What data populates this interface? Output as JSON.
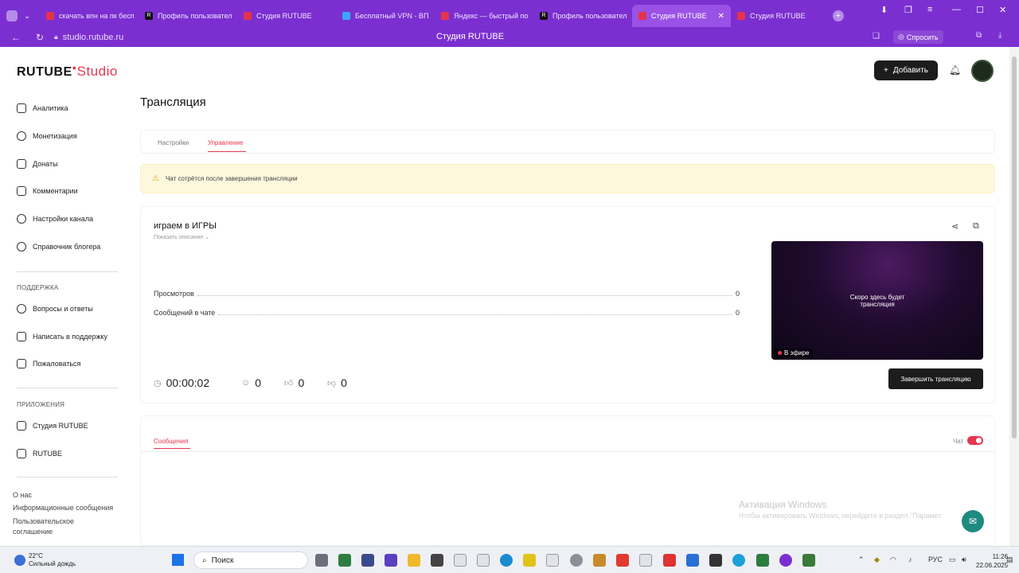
{
  "browser": {
    "tabs": [
      {
        "label": "скачать впн на пк бесп",
        "favicon": "yandex-icon",
        "active": false
      },
      {
        "label": "Профиль пользовател",
        "favicon": "rutube-icon",
        "active": false
      },
      {
        "label": "Студия RUTUBE",
        "favicon": "studio-icon",
        "active": false
      },
      {
        "label": "Бесплатный VPN - ВП",
        "favicon": "vpn-icon",
        "active": false
      },
      {
        "label": "Яндекс — быстрый по",
        "favicon": "yandex-icon",
        "active": false
      },
      {
        "label": "Профиль пользовател",
        "favicon": "rutube-icon",
        "active": false
      },
      {
        "label": "Студия RUTUBE",
        "favicon": "studio-icon",
        "active": true
      },
      {
        "label": "Студия RUTUBE",
        "favicon": "studio-icon",
        "active": false
      }
    ],
    "url": "studio.rutube.ru",
    "page_title": "Студия RUTUBE",
    "ask_label": "Спросить",
    "accent": "#7b2fd0"
  },
  "header": {
    "logo_main": "RUTUBE",
    "logo_studio": "Studio",
    "add_label": "Добавить"
  },
  "sidebar": {
    "items": [
      {
        "label": "Аналитика",
        "icon": "chart-icon"
      },
      {
        "label": "Монетизация",
        "icon": "coin-icon"
      },
      {
        "label": "Донаты",
        "icon": "gift-icon"
      },
      {
        "label": "Комментарии",
        "icon": "comment-icon"
      },
      {
        "label": "Настройки канала",
        "icon": "gear-icon"
      },
      {
        "label": "Справочник блогера",
        "icon": "info-icon"
      }
    ],
    "support_title": "ПОДДЕРЖКА",
    "support_items": [
      {
        "label": "Вопросы и ответы",
        "icon": "question-icon"
      },
      {
        "label": "Написать в поддержку",
        "icon": "mail-icon"
      },
      {
        "label": "Пожаловаться",
        "icon": "flag-icon"
      }
    ],
    "apps_title": "ПРИЛОЖЕНИЯ",
    "apps_items": [
      {
        "label": "Студия RUTUBE",
        "icon": "studio-app-icon"
      },
      {
        "label": "RUTUBE",
        "icon": "rutube-app-icon"
      }
    ],
    "footer": [
      "О нас",
      "Информационные сообщения",
      "Пользовательское соглашение"
    ]
  },
  "main": {
    "title": "Трансляция",
    "tabs": [
      "Настройки",
      "Управление"
    ],
    "active_tab": "Управление",
    "warning": "Чат сотрётся после завершения трансляции",
    "stream": {
      "title": "играем в ИГРЫ",
      "show_description": "Показать описание",
      "stats": [
        {
          "label": "Просмотров",
          "value": "0"
        },
        {
          "label": "Сообщений в чате",
          "value": "0"
        }
      ],
      "duration": "00:00:02",
      "viewers": "0",
      "likes": "0",
      "dislikes": "0",
      "player_text": "Скоро здесь будет трансляция",
      "live_label": "В эфире",
      "end_button": "Завершить трансляцию"
    },
    "messages_tab": "Сообщения",
    "chat_label": "Чат",
    "chat_enabled": true,
    "accent": "#e8364f"
  },
  "watermark": {
    "line1": "Активация Windows",
    "line2": "Чтобы активировать Windows, перейдите в раздел \"Парамет"
  },
  "taskbar": {
    "temperature": "22°C",
    "weather": "Сильный дождь",
    "search_placeholder": "Поиск",
    "lang": "РУС",
    "time": "11:26",
    "date": "22.06.2025"
  }
}
